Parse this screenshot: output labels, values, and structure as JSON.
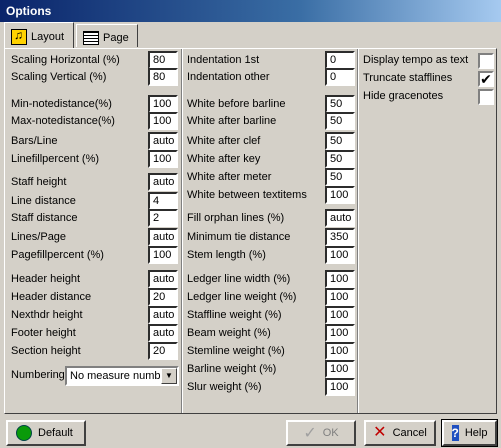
{
  "window": {
    "title": "Options"
  },
  "tabs": [
    {
      "label": "Layout",
      "icon": "music-book-icon"
    },
    {
      "label": "Page",
      "icon": "page-icon"
    }
  ],
  "left": {
    "fields": [
      {
        "label": "Scaling Horizontal (%)",
        "value": "80"
      },
      {
        "label": "Scaling Vertical (%)",
        "value": "80"
      },
      {
        "label": "Min-notedistance(%)",
        "value": "100"
      },
      {
        "label": "Max-notedistance(%)",
        "value": "100"
      },
      {
        "label": "Bars/Line",
        "value": "auto"
      },
      {
        "label": "Linefillpercent (%)",
        "value": "100"
      },
      {
        "label": "Staff height",
        "value": "auto"
      },
      {
        "label": "Line distance",
        "value": "4"
      },
      {
        "label": "Staff distance",
        "value": "2"
      },
      {
        "label": "Lines/Page",
        "value": "auto"
      },
      {
        "label": "Pagefillpercent (%)",
        "value": "100"
      },
      {
        "label": "Header height",
        "value": "auto"
      },
      {
        "label": "Header distance",
        "value": "20"
      },
      {
        "label": "Nexthdr height",
        "value": "auto"
      },
      {
        "label": "Footer height",
        "value": "auto"
      },
      {
        "label": "Section height",
        "value": "20"
      }
    ],
    "numbering": {
      "label": "Numbering",
      "value": "No measure numbe"
    }
  },
  "middle": {
    "fields": [
      {
        "label": "Indentation 1st",
        "value": "0"
      },
      {
        "label": "Indentation other",
        "value": "0"
      },
      {
        "label": "White before barline",
        "value": "50"
      },
      {
        "label": "White after barline",
        "value": "50"
      },
      {
        "label": "White after clef",
        "value": "50"
      },
      {
        "label": "White after key",
        "value": "50"
      },
      {
        "label": "White after meter",
        "value": "50"
      },
      {
        "label": "White between textitems",
        "value": "100"
      },
      {
        "label": "Fill orphan lines (%)",
        "value": "auto"
      },
      {
        "label": "Minimum tie distance",
        "value": "350"
      },
      {
        "label": "Stem length (%)",
        "value": "100"
      },
      {
        "label": "Ledger line width (%)",
        "value": "100"
      },
      {
        "label": "Ledger line weight (%)",
        "value": "100"
      },
      {
        "label": "Staffline weight (%)",
        "value": "100"
      },
      {
        "label": "Beam weight (%)",
        "value": "100"
      },
      {
        "label": "Stemline weight (%)",
        "value": "100"
      },
      {
        "label": "Barline weight (%)",
        "value": "100"
      },
      {
        "label": "Slur weight (%)",
        "value": "100"
      }
    ]
  },
  "right": {
    "checks": [
      {
        "label": "Display tempo as text",
        "checked": ""
      },
      {
        "label": "Truncate stafflines",
        "checked": "✔"
      },
      {
        "label": "Hide gracenotes",
        "checked": ""
      }
    ]
  },
  "footer": {
    "default_label": "Default",
    "ok_label": "OK",
    "cancel_label": "Cancel",
    "help_label": "Help"
  }
}
